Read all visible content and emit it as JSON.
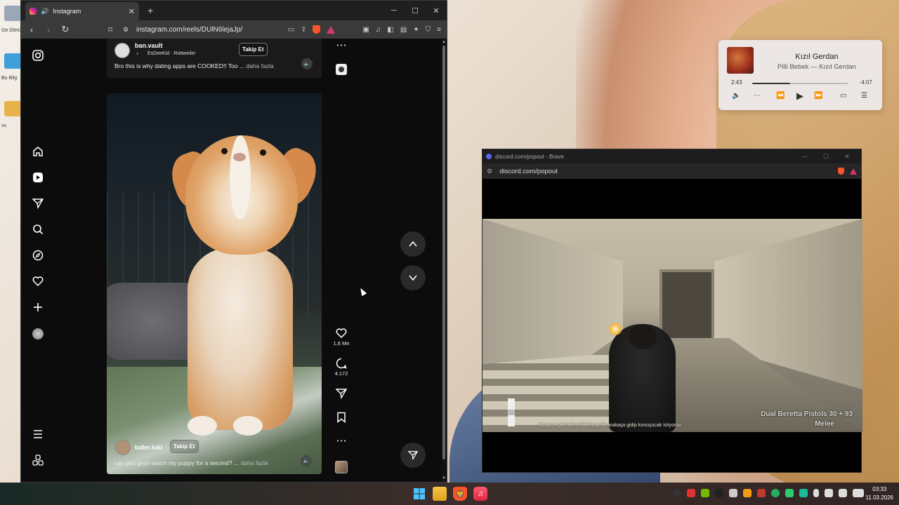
{
  "desktop": {
    "icons": [
      {
        "label": "Ge Dönü",
        "color": "#9aa7b8"
      },
      {
        "label": "Bu Bilg",
        "color": "#3da0d8"
      },
      {
        "label": "vs",
        "color": "#e8b24a"
      }
    ]
  },
  "browser": {
    "tab_title": "Instagram",
    "new_tab": "+",
    "url": "instagram.com/reels/DUlN6lejaJp/",
    "controls": {
      "minimize": "─",
      "maximize": "☐",
      "close": "✕"
    }
  },
  "ig": {
    "top_reel": {
      "username": "ban.vault",
      "audio": "EsDeeKid · Rottweiler",
      "follow": "Takip Et",
      "caption": "Bro this is why dating apps are COOKED!! Too ...",
      "more": "daha fazla"
    },
    "current_reel": {
      "username": "toller.loki",
      "follow": "Takip Et",
      "caption": "can you guys watch my puppy for a second? ...",
      "more": "daha fazla"
    },
    "actions": {
      "likes": "1,6 Mn",
      "comments": "4.172"
    }
  },
  "media": {
    "song": "Kızıl Gerdan",
    "artist": "Pilli Bebek — Kızıl Gerdan",
    "elapsed": "2:43",
    "remaining": "-4:07",
    "progress": 0.4
  },
  "discord": {
    "title": "discord.com/popout - Brave",
    "url": "discord.com/popout",
    "game": {
      "subtitle": "Bosan'u görmek tehlikeliysa bir arakaşa gidip konuşucak istiyoruz",
      "weapon": "Dual Beretta Pistols  30 + 93",
      "mode": "Melee"
    }
  },
  "clock": {
    "time": "03:33",
    "date": "11.03.2026"
  }
}
